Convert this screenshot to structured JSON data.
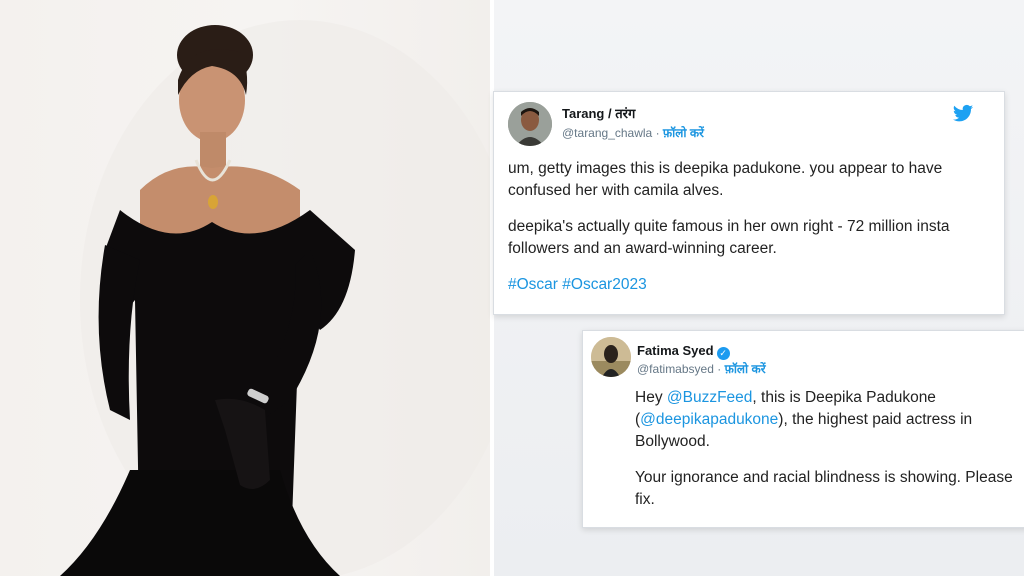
{
  "photo": {
    "subject": "woman-in-black-gown",
    "background_color": "#f4f1ee"
  },
  "tweets": [
    {
      "name": "Tarang / तरंग",
      "handle": "@tarang_chawla",
      "separator": " · ",
      "follow": "फ़ॉलो करें",
      "paragraphs": [
        "um, getty images this is deepika padukone. you appear to have confused her with camila alves.",
        "deepika's actually quite famous in her own right - 72 million insta followers and an award-winning career."
      ],
      "hashtags": "#Oscar #Oscar2023",
      "icon": "twitter-bird-icon"
    },
    {
      "name": "Fatima Syed",
      "verified": "✓",
      "handle": "@fatimabsyed",
      "separator": " · ",
      "follow": "फ़ॉलो करें",
      "p1_pre": "Hey ",
      "p1_link1": "@BuzzFeed",
      "p1_mid": ", this is Deepika Padukone (",
      "p1_link2": "@deepikapadukone",
      "p1_post": "), the highest paid actress in Bollywood.",
      "p2": "Your ignorance and racial blindness is showing. Please fix."
    }
  ],
  "colors": {
    "link": "#1b95e0",
    "twitter_blue": "#1da1f2",
    "verified": "#1d9bf0"
  }
}
